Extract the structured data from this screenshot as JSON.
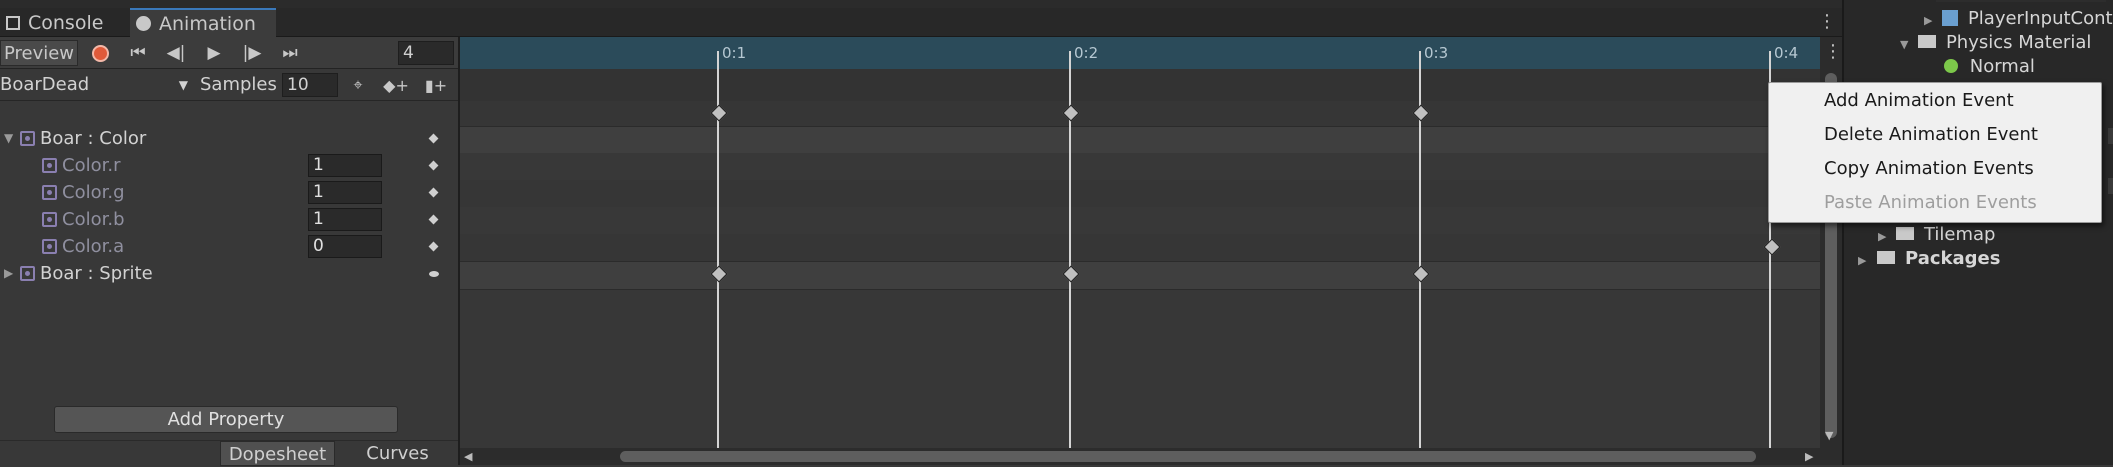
{
  "tabs": [
    {
      "label": "Console",
      "icon": "console-icon"
    },
    {
      "label": "Animation",
      "icon": "animation-clock-icon"
    }
  ],
  "toolbar": {
    "preview_label": "Preview",
    "frame_value": "4",
    "buttons": [
      "record-button",
      "first-keyframe-button",
      "prev-keyframe-button",
      "play-button",
      "next-keyframe-button",
      "last-keyframe-button"
    ]
  },
  "clip": {
    "selected": "BoarDead",
    "samples_label": "Samples",
    "samples_value": "10"
  },
  "properties": [
    {
      "label": "Boar : Color",
      "expanded": true,
      "level": 0
    },
    {
      "label": "Color.r",
      "value": "1",
      "level": 1
    },
    {
      "label": "Color.g",
      "value": "1",
      "level": 1
    },
    {
      "label": "Color.b",
      "value": "1",
      "level": 1
    },
    {
      "label": "Color.a",
      "value": "0",
      "level": 1
    },
    {
      "label": "Boar : Sprite",
      "expanded": false,
      "level": 0
    }
  ],
  "add_property_label": "Add Property",
  "bottom_tabs": [
    "Dopesheet",
    "Curves"
  ],
  "timeline": {
    "ticks": [
      "0:1",
      "0:2",
      "0:3",
      "0:4"
    ]
  },
  "hierarchy": {
    "items": [
      "PlayerInputContr",
      "Physics Material",
      "Normal",
      "Tilemap",
      "Packages"
    ]
  },
  "context_menu": {
    "items": [
      {
        "label": "Add Animation Event",
        "enabled": true
      },
      {
        "label": "Delete Animation Event",
        "enabled": true
      },
      {
        "label": "Copy Animation Events",
        "enabled": true
      },
      {
        "label": "Paste Animation Events",
        "enabled": false
      }
    ]
  },
  "colors": {
    "accent_tab": "#3a79bb",
    "ruler_bg": "#2b4b5a",
    "record_red": "#e05a3a",
    "menu_bg": "#f0f0f0"
  }
}
